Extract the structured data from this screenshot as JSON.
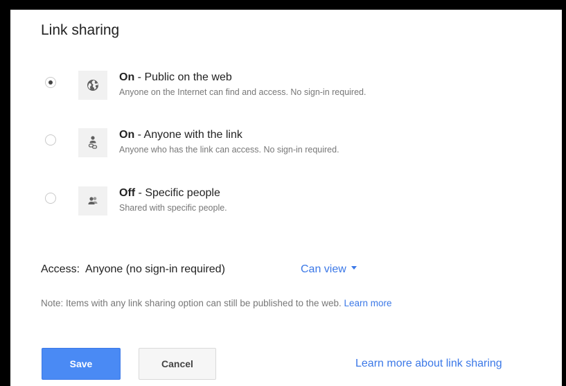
{
  "dialog": {
    "title": "Link sharing",
    "options": [
      {
        "status": "On",
        "label": " - Public on the web",
        "description": "Anyone on the Internet can find and access. No sign-in required.",
        "icon": "globe-icon",
        "selected": true
      },
      {
        "status": "On",
        "label": " - Anyone with the link",
        "description": "Anyone who has the link can access. No sign-in required.",
        "icon": "person-link-icon",
        "selected": false
      },
      {
        "status": "Off",
        "label": " - Specific people",
        "description": "Shared with specific people.",
        "icon": "people-icon",
        "selected": false
      }
    ],
    "access": {
      "label": "Access:",
      "value": "Anyone (no sign-in required)",
      "permission": "Can view"
    },
    "note": {
      "text": "Note: Items with any link sharing option can still be published to the web.",
      "link": "Learn more"
    },
    "buttons": {
      "save": "Save",
      "cancel": "Cancel"
    },
    "learn_more_link": "Learn more about link sharing",
    "colors": {
      "accent": "#4a8af4",
      "link": "#3b78e7"
    }
  }
}
